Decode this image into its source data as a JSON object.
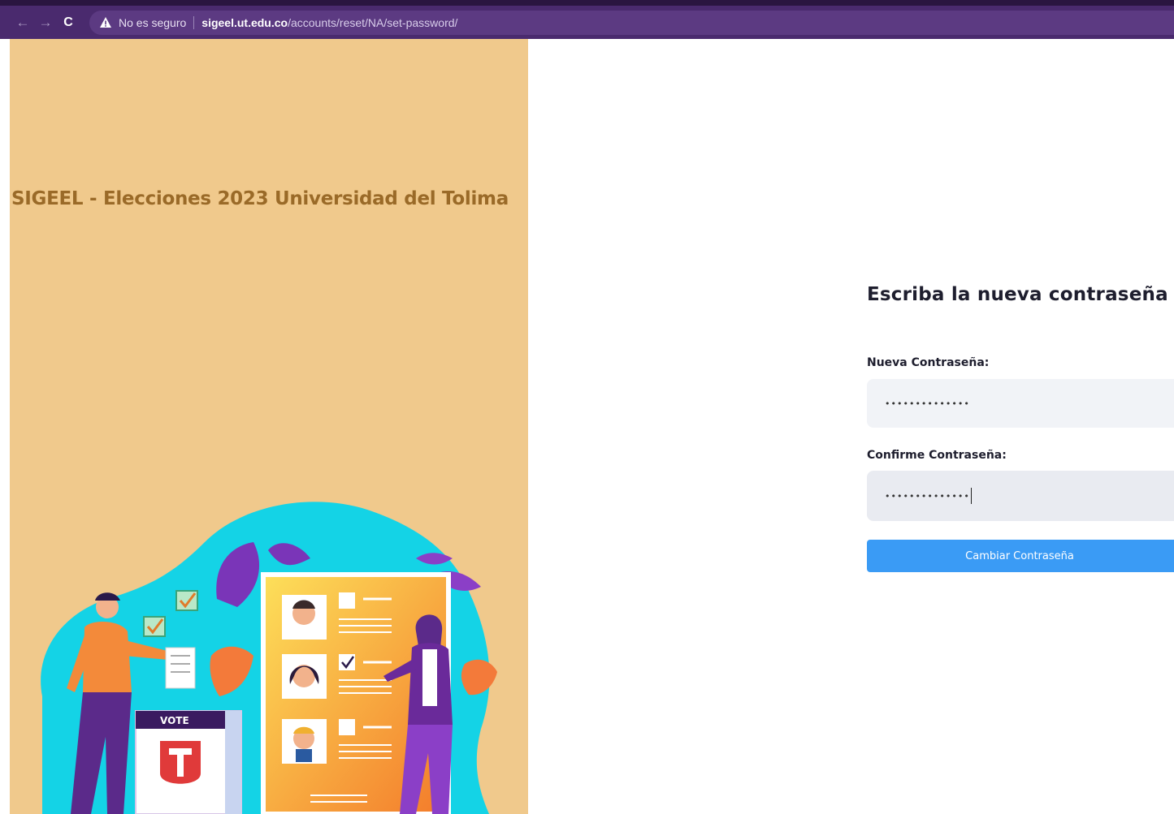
{
  "browser": {
    "security_label": "No es seguro",
    "url_host": "sigeel.ut.edu.co",
    "url_path": "/accounts/reset/NA/set-password/"
  },
  "site": {
    "title": "SIGEEL - Elecciones 2023 Universidad del Tolima",
    "ballot_box_label": "VOTE"
  },
  "form": {
    "title": "Escriba la nueva contraseña",
    "new_password_label": "Nueva Contraseña:",
    "new_password_value": "••••••••••••••",
    "confirm_password_label": "Confirme Contraseña:",
    "confirm_password_value": "••••••••••••••",
    "submit_label": "Cambiar Contraseña"
  },
  "colors": {
    "panel_bg": "#f0c98c",
    "title_color": "#9a6a28",
    "button_bg": "#3a9bf5",
    "browser_bar": "#4a2a6e"
  }
}
